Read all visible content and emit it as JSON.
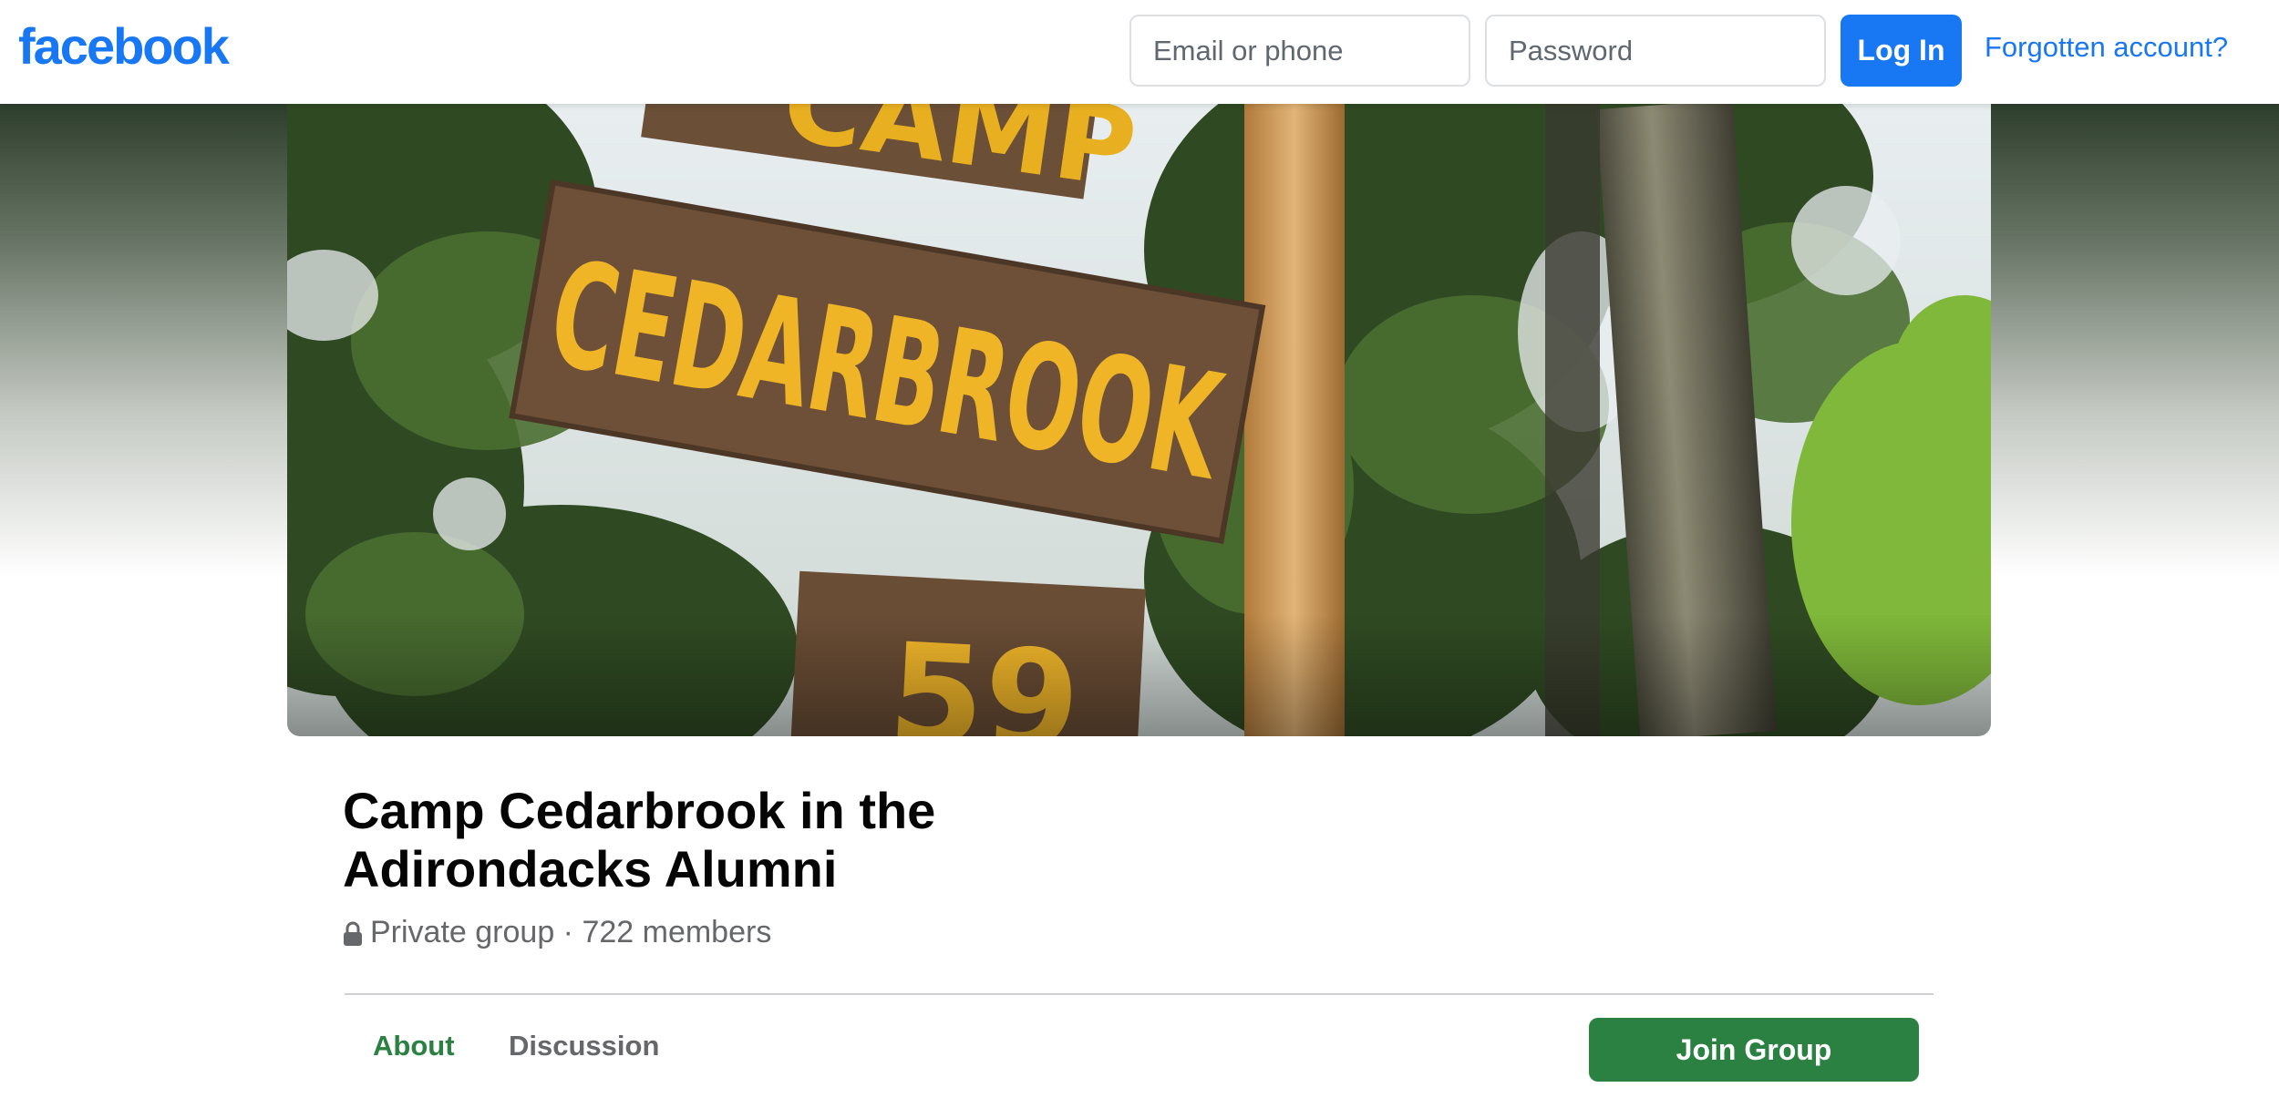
{
  "header": {
    "logo_text": "facebook",
    "email_placeholder": "Email or phone",
    "password_placeholder": "Password",
    "login_label": "Log In",
    "forgot_label": "Forgotten account?"
  },
  "cover": {
    "sign_text": "CEDARBROOK",
    "top_sign_text": "CAMP",
    "bottom_sign_text": "59"
  },
  "group": {
    "title": "Camp Cedarbrook in the Adirondacks Alumni",
    "privacy": "Private group",
    "separator": " · ",
    "members": "722 members"
  },
  "tabs": [
    {
      "label": "About",
      "active": true
    },
    {
      "label": "Discussion",
      "active": false
    }
  ],
  "join_label": "Join Group",
  "colors": {
    "brand_blue": "#1877f2",
    "group_green": "#2a8142",
    "muted_text": "#65676b"
  },
  "icons": {
    "lock": "lock-icon"
  }
}
